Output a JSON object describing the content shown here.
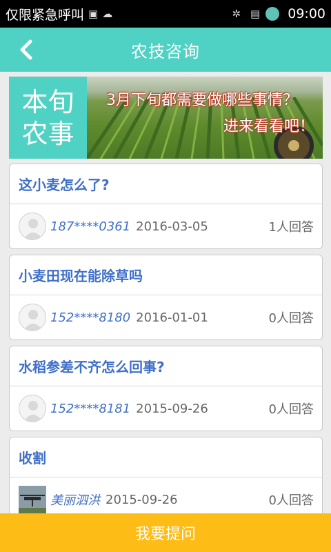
{
  "status_bar": {
    "carrier": "仅限紧急呼叫",
    "time": "09:00",
    "icons": [
      "gallery-icon",
      "cloud-icon",
      "sync-icon",
      "sim-icon",
      "battery-icon"
    ]
  },
  "header": {
    "title": "农技咨询",
    "back_icon": "chevron-left-icon"
  },
  "banner": {
    "label_line1": "本旬",
    "label_line2": "农事",
    "caption_line1": "3月下旬都需要做哪些事情？",
    "caption_line2": "进来看看吧！"
  },
  "questions": [
    {
      "title": "这小麦怎么了?",
      "user": "187****0361",
      "date": "2016-03-05",
      "answers": "1人回答",
      "avatar": "default-avatar"
    },
    {
      "title": "小麦田现在能除草吗",
      "user": "152****8180",
      "date": "2016-01-01",
      "answers": "0人回答",
      "avatar": "default-avatar"
    },
    {
      "title": "水稻参差不齐怎么回事?",
      "user": "152****8181",
      "date": "2015-09-26",
      "answers": "0人回答",
      "avatar": "default-avatar"
    },
    {
      "title": "收割",
      "user": "美丽泗洪",
      "date": "2015-09-26",
      "answers": "0人回答",
      "avatar": "photo-avatar"
    }
  ],
  "footer": {
    "ask_label": "我要提问"
  },
  "colors": {
    "accent": "#4fd1c3",
    "link": "#3f6fc9",
    "ask_button": "#fdbc16"
  }
}
